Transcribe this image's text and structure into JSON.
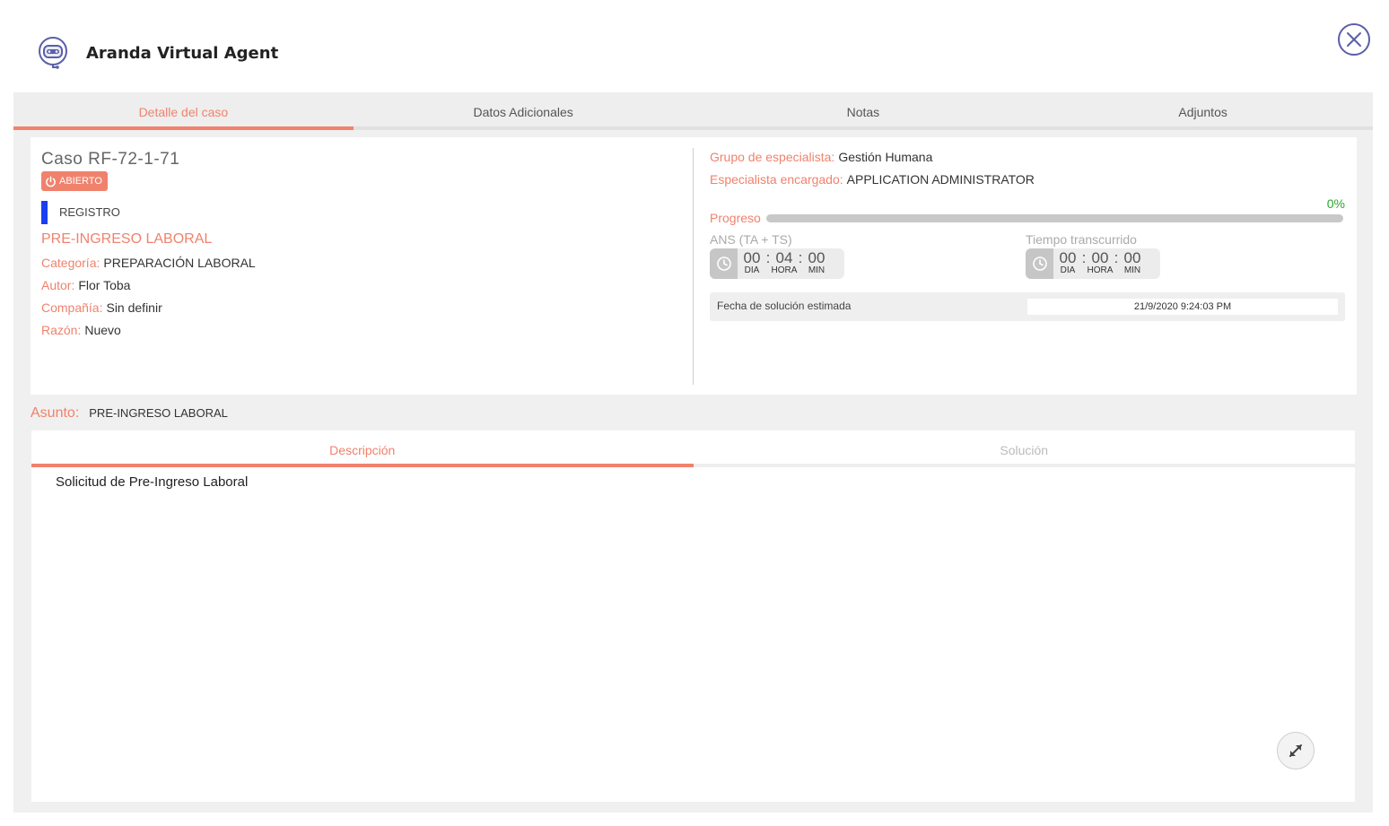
{
  "app": {
    "title": "Aranda Virtual Agent",
    "logo_icon": "robot-agent-icon",
    "close_icon": "close-circle-icon"
  },
  "colors": {
    "accent": "#f0826d",
    "stage": "#1a3ff2",
    "success": "#2aa52a",
    "close": "#5a5fa8"
  },
  "tabs": [
    {
      "label": "Detalle del caso",
      "active": true
    },
    {
      "label": "Datos Adicionales",
      "active": false
    },
    {
      "label": "Notas",
      "active": false
    },
    {
      "label": "Adjuntos",
      "active": false
    }
  ],
  "case": {
    "title": "Caso RF-72-1-71",
    "status": "ABIERTO",
    "stage": "REGISTRO",
    "subject": "PRE-INGRESO LABORAL",
    "fields": [
      {
        "label": "Categoría:",
        "value": "PREPARACIÓN LABORAL"
      },
      {
        "label": "Autor:",
        "value": "Flor Toba"
      },
      {
        "label": "Compañía:",
        "value": "Sin definir"
      },
      {
        "label": "Razón:",
        "value": "Nuevo"
      }
    ]
  },
  "assignment": {
    "group_label": "Grupo de especialista:",
    "group_value": "Gestión Humana",
    "specialist_label": "Especialista encargado:",
    "specialist_value": "APPLICATION ADMINISTRATOR"
  },
  "progress": {
    "label": "Progreso",
    "percent_text": "0%",
    "fraction": 0
  },
  "ans": {
    "title": "ANS (TA + TS)",
    "dia": "00",
    "hora": "04",
    "min": "00"
  },
  "elapsed": {
    "title": "Tiempo transcurrido",
    "dia": "00",
    "hora": "00",
    "min": "00"
  },
  "units": {
    "dia": "DIA",
    "hora": "HORA",
    "min": "MIN",
    "sep": ":"
  },
  "estimate": {
    "label": "Fecha de solución estimada",
    "value": "21/9/2020 9:24:03 PM"
  },
  "asunto": {
    "label": "Asunto:",
    "value": "PRE-INGRESO LABORAL"
  },
  "desc_tabs": [
    {
      "label": "Descripción",
      "active": true
    },
    {
      "label": "Solución",
      "active": false
    }
  ],
  "description": "Solicitud de Pre-Ingreso Laboral"
}
